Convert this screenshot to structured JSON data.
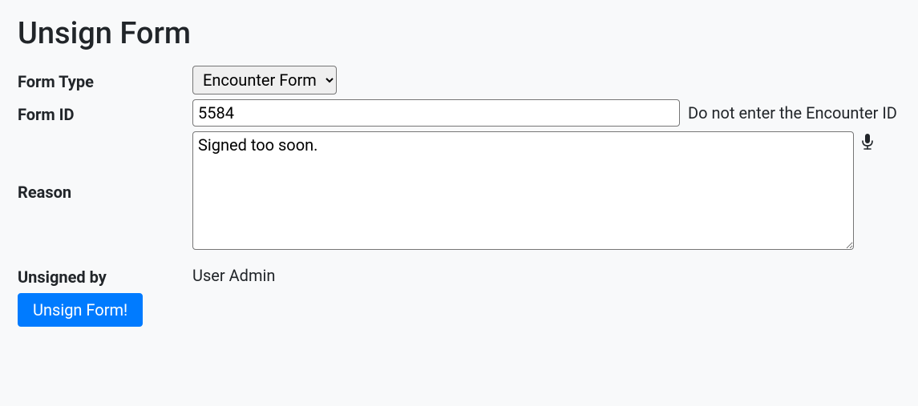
{
  "title": "Unsign Form",
  "fields": {
    "formType": {
      "label": "Form Type",
      "selected": "Encounter Form"
    },
    "formId": {
      "label": "Form ID",
      "value": "5584",
      "hint": "Do not enter the Encounter ID"
    },
    "reason": {
      "label": "Reason",
      "value": "Signed too soon."
    },
    "unsignedBy": {
      "label": "Unsigned by",
      "value": "User Admin"
    }
  },
  "actions": {
    "submit": "Unsign Form!"
  }
}
